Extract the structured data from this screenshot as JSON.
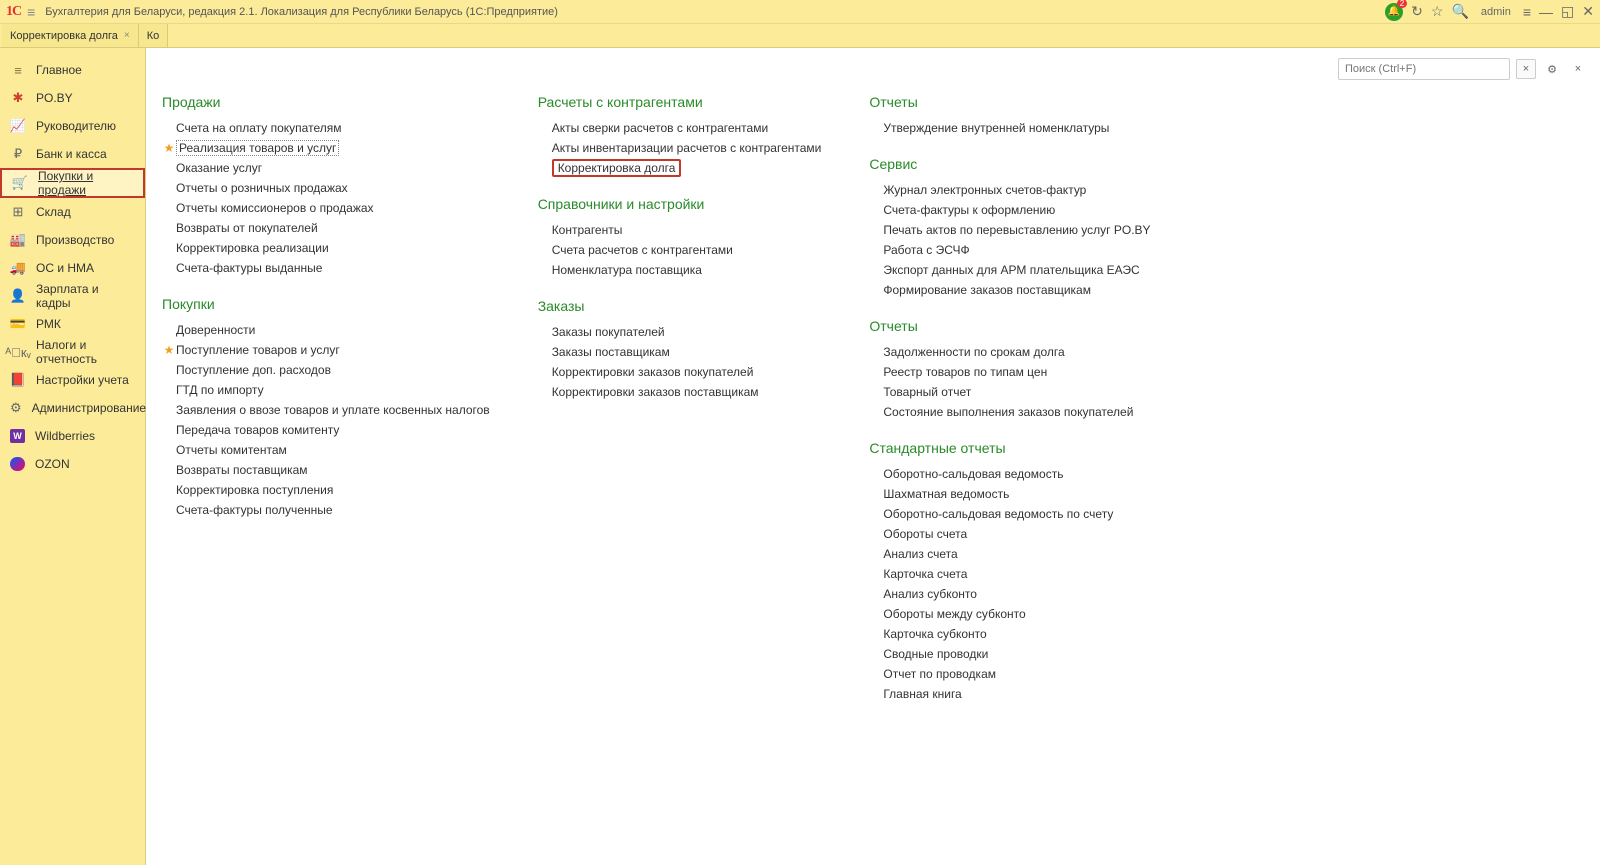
{
  "titlebar": {
    "brand": "1С",
    "title": "Бухгалтерия для Беларуси, редакция 2.1. Локализация для Республики Беларусь   (1С:Предприятие)",
    "badge": "2",
    "user": "admin"
  },
  "tabs": [
    {
      "label": "Корректировка долга",
      "closable": true
    },
    {
      "label": "Ко",
      "closable": false
    }
  ],
  "sidebar": [
    {
      "icon": "≡",
      "label": "Главное",
      "class": "brown"
    },
    {
      "icon": "✱",
      "label": "PO.BY",
      "class": "red"
    },
    {
      "icon": "📈",
      "label": "Руководителю"
    },
    {
      "icon": "₽",
      "label": "Банк и касса"
    },
    {
      "icon": "🛒",
      "label": "Покупки и продажи",
      "active": true,
      "underline": true
    },
    {
      "icon": "⊞",
      "label": "Склад"
    },
    {
      "icon": "🏭",
      "label": "Производство"
    },
    {
      "icon": "🚚",
      "label": "ОС и НМА"
    },
    {
      "icon": "👤",
      "label": "Зарплата и кадры"
    },
    {
      "icon": "💳",
      "label": "РМК"
    },
    {
      "icon": "ᴬᷝкᵥ",
      "label": "Налоги и отчетность"
    },
    {
      "icon": "📕",
      "label": "Настройки учета"
    },
    {
      "icon": "⚙",
      "label": "Администрирование"
    },
    {
      "icon": "W",
      "label": "Wildberries",
      "class": "purple"
    },
    {
      "icon": "",
      "label": "OZON",
      "class": "ozon"
    }
  ],
  "search": {
    "placeholder": "Поиск (Ctrl+F)"
  },
  "columns": [
    {
      "sections": [
        {
          "title": "Продажи",
          "items": [
            {
              "label": "Счета на оплату покупателям"
            },
            {
              "label": "Реализация товаров и услуг",
              "star": true,
              "dotted": true
            },
            {
              "label": "Оказание услуг"
            },
            {
              "label": "Отчеты о розничных продажах"
            },
            {
              "label": "Отчеты комиссионеров о продажах"
            },
            {
              "label": "Возвраты от покупателей"
            },
            {
              "label": "Корректировка реализации"
            },
            {
              "label": "Счета-фактуры выданные"
            }
          ]
        },
        {
          "title": "Покупки",
          "items": [
            {
              "label": "Доверенности"
            },
            {
              "label": "Поступление товаров и услуг",
              "star": true
            },
            {
              "label": "Поступление доп. расходов"
            },
            {
              "label": "ГТД по импорту"
            },
            {
              "label": "Заявления о ввозе товаров и уплате косвенных налогов"
            },
            {
              "label": "Передача товаров комитенту"
            },
            {
              "label": "Отчеты комитентам"
            },
            {
              "label": "Возвраты поставщикам"
            },
            {
              "label": "Корректировка поступления"
            },
            {
              "label": "Счета-фактуры полученные"
            }
          ]
        }
      ]
    },
    {
      "sections": [
        {
          "title": "Расчеты с контрагентами",
          "items": [
            {
              "label": "Акты сверки расчетов с контрагентами"
            },
            {
              "label": "Акты инвентаризации расчетов с контрагентами"
            },
            {
              "label": "Корректировка долга",
              "boxed": true
            }
          ]
        },
        {
          "title": "Справочники и настройки",
          "items": [
            {
              "label": "Контрагенты"
            },
            {
              "label": "Счета расчетов с контрагентами"
            },
            {
              "label": "Номенклатура поставщика"
            }
          ]
        },
        {
          "title": "Заказы",
          "items": [
            {
              "label": "Заказы покупателей"
            },
            {
              "label": "Заказы поставщикам"
            },
            {
              "label": "Корректировки заказов покупателей"
            },
            {
              "label": "Корректировки заказов поставщикам"
            }
          ]
        }
      ]
    },
    {
      "sections": [
        {
          "title": "Отчеты",
          "items": [
            {
              "label": "Утверждение внутренней номенклатуры"
            }
          ]
        },
        {
          "title": "Сервис",
          "items": [
            {
              "label": "Журнал электронных счетов-фактур"
            },
            {
              "label": "Счета-фактуры к оформлению"
            },
            {
              "label": "Печать актов по перевыставлению услуг PO.BY"
            },
            {
              "label": "Работа с ЭСЧФ"
            },
            {
              "label": "Экспорт данных для АРМ плательщика ЕАЭС"
            },
            {
              "label": "Формирование заказов поставщикам"
            }
          ]
        },
        {
          "title": "Отчеты",
          "items": [
            {
              "label": "Задолженности по срокам долга"
            },
            {
              "label": "Реестр товаров по типам цен"
            },
            {
              "label": "Товарный отчет"
            },
            {
              "label": "Состояние выполнения заказов покупателей"
            }
          ]
        },
        {
          "title": "Стандартные отчеты",
          "items": [
            {
              "label": "Оборотно-сальдовая ведомость"
            },
            {
              "label": "Шахматная ведомость"
            },
            {
              "label": "Оборотно-сальдовая ведомость по счету"
            },
            {
              "label": "Обороты счета"
            },
            {
              "label": "Анализ счета"
            },
            {
              "label": "Карточка счета"
            },
            {
              "label": "Анализ субконто"
            },
            {
              "label": "Обороты между субконто"
            },
            {
              "label": "Карточка субконто"
            },
            {
              "label": "Сводные проводки"
            },
            {
              "label": "Отчет по проводкам"
            },
            {
              "label": "Главная книга"
            }
          ]
        }
      ]
    }
  ]
}
